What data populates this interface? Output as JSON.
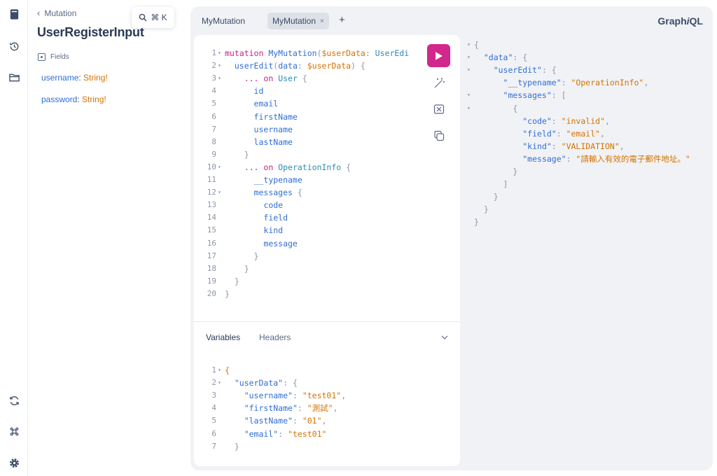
{
  "docs": {
    "back_label": "Mutation",
    "title": "UserRegisterInput",
    "fields_label": "Fields",
    "fields": [
      {
        "name": "username",
        "type": "String",
        "suffix": "!"
      },
      {
        "name": "password",
        "type": "String",
        "suffix": "!"
      }
    ]
  },
  "search": {
    "label": "⌘ K"
  },
  "tabs": [
    {
      "label": "MyMutation"
    },
    {
      "label": "MyMutation",
      "close": "×"
    }
  ],
  "tab_add": "+",
  "brand": {
    "prefix": "Graph",
    "italic": "i",
    "suffix": "QL"
  },
  "variables_tab": "Variables",
  "headers_tab": "Headers",
  "colors": {
    "accent": "#d2278c",
    "field": "#2f6ed6",
    "type": "#d47300",
    "keyword": "#c4237f"
  },
  "icons": {
    "rail": [
      "docs-icon",
      "history-icon",
      "explorer-icon",
      "refetch-schema-icon",
      "shortcuts-icon",
      "settings-icon"
    ],
    "editor_tools": [
      "run-icon",
      "prettify-icon",
      "merge-icon",
      "copy-icon"
    ]
  },
  "query_lines": [
    [
      "1",
      [
        [
          "kw",
          "mutation "
        ],
        [
          "op",
          "MyMutation"
        ],
        [
          "pn",
          "("
        ],
        [
          "var",
          "$userData"
        ],
        [
          "pn",
          ": "
        ],
        [
          "ty",
          "UserEdi"
        ]
      ]
    ],
    [
      "2",
      [
        [
          "pn",
          "  "
        ],
        [
          "fd",
          "userEdit"
        ],
        [
          "pn",
          "("
        ],
        [
          "fd",
          "data"
        ],
        [
          "pn",
          ": "
        ],
        [
          "var",
          "$userData"
        ],
        [
          "pn",
          ") {"
        ]
      ]
    ],
    [
      "3",
      [
        [
          "pn",
          "    "
        ],
        [
          "kw",
          "... on "
        ],
        [
          "ty",
          "User"
        ],
        [
          "pn",
          " {"
        ]
      ]
    ],
    [
      "4",
      [
        [
          "pn",
          "      "
        ],
        [
          "fd",
          "id"
        ]
      ]
    ],
    [
      "5",
      [
        [
          "pn",
          "      "
        ],
        [
          "fd",
          "email"
        ]
      ]
    ],
    [
      "6",
      [
        [
          "pn",
          "      "
        ],
        [
          "fd",
          "firstName"
        ]
      ]
    ],
    [
      "7",
      [
        [
          "pn",
          "      "
        ],
        [
          "fd",
          "username"
        ]
      ]
    ],
    [
      "8",
      [
        [
          "pn",
          "      "
        ],
        [
          "fd",
          "lastName"
        ]
      ]
    ],
    [
      "9",
      [
        [
          "pn",
          "    }"
        ]
      ]
    ],
    [
      "10",
      [
        [
          "pn",
          "    "
        ],
        [
          "kw",
          "... on "
        ],
        [
          "ty",
          "OperationInfo"
        ],
        [
          "pn",
          " {"
        ]
      ]
    ],
    [
      "11",
      [
        [
          "pn",
          "      "
        ],
        [
          "fd",
          "__typename"
        ]
      ]
    ],
    [
      "12",
      [
        [
          "pn",
          "      "
        ],
        [
          "fd",
          "messages"
        ],
        [
          "pn",
          " {"
        ]
      ]
    ],
    [
      "13",
      [
        [
          "pn",
          "        "
        ],
        [
          "fd",
          "code"
        ]
      ]
    ],
    [
      "14",
      [
        [
          "pn",
          "        "
        ],
        [
          "fd",
          "field"
        ]
      ]
    ],
    [
      "15",
      [
        [
          "pn",
          "        "
        ],
        [
          "fd",
          "kind"
        ]
      ]
    ],
    [
      "16",
      [
        [
          "pn",
          "        "
        ],
        [
          "fd",
          "message"
        ]
      ]
    ],
    [
      "17",
      [
        [
          "pn",
          "      }"
        ]
      ]
    ],
    [
      "18",
      [
        [
          "pn",
          "    }"
        ]
      ]
    ],
    [
      "19",
      [
        [
          "pn",
          "  }"
        ]
      ]
    ],
    [
      "20",
      [
        [
          "pn",
          "}"
        ]
      ]
    ]
  ],
  "variables_lines": [
    [
      "1",
      [
        [
          "st",
          "{"
        ]
      ]
    ],
    [
      "2",
      [
        [
          "pn",
          "  "
        ],
        [
          "jk",
          "\"userData\""
        ],
        [
          "pn",
          ": {"
        ]
      ]
    ],
    [
      "3",
      [
        [
          "pn",
          "    "
        ],
        [
          "jk",
          "\"username\""
        ],
        [
          "pn",
          ": "
        ],
        [
          "st",
          "\"test01\""
        ],
        [
          "pn",
          ","
        ]
      ]
    ],
    [
      "4",
      [
        [
          "pn",
          "    "
        ],
        [
          "jk",
          "\"firstName\""
        ],
        [
          "pn",
          ": "
        ],
        [
          "st",
          "\"測試\""
        ],
        [
          "pn",
          ","
        ]
      ]
    ],
    [
      "5",
      [
        [
          "pn",
          "    "
        ],
        [
          "jk",
          "\"lastName\""
        ],
        [
          "pn",
          ": "
        ],
        [
          "st",
          "\"01\""
        ],
        [
          "pn",
          ","
        ]
      ]
    ],
    [
      "6",
      [
        [
          "pn",
          "    "
        ],
        [
          "jk",
          "\"email\""
        ],
        [
          "pn",
          ": "
        ],
        [
          "st",
          "\"test01\""
        ]
      ]
    ],
    [
      "7",
      [
        [
          "pn",
          "  }"
        ]
      ]
    ]
  ],
  "result_lines": [
    [
      [
        [
          "pn",
          "{"
        ]
      ]
    ],
    [
      [
        [
          "pn",
          "  "
        ],
        [
          "jk",
          "\"data\""
        ],
        [
          "pn",
          ": {"
        ]
      ]
    ],
    [
      [
        [
          "pn",
          "    "
        ],
        [
          "jk",
          "\"userEdit\""
        ],
        [
          "pn",
          ": {"
        ]
      ]
    ],
    [
      [
        [
          "pn",
          "      "
        ],
        [
          "jk",
          "\"__typename\""
        ],
        [
          "pn",
          ": "
        ],
        [
          "st",
          "\"OperationInfo\""
        ],
        [
          "pn",
          ","
        ]
      ]
    ],
    [
      [
        [
          "pn",
          "      "
        ],
        [
          "jk",
          "\"messages\""
        ],
        [
          "pn",
          ": ["
        ]
      ]
    ],
    [
      [
        [
          "pn",
          "        {"
        ]
      ]
    ],
    [
      [
        [
          "pn",
          "          "
        ],
        [
          "jk",
          "\"code\""
        ],
        [
          "pn",
          ": "
        ],
        [
          "st",
          "\"invalid\""
        ],
        [
          "pn",
          ","
        ]
      ]
    ],
    [
      [
        [
          "pn",
          "          "
        ],
        [
          "jk",
          "\"field\""
        ],
        [
          "pn",
          ": "
        ],
        [
          "st",
          "\"email\""
        ],
        [
          "pn",
          ","
        ]
      ]
    ],
    [
      [
        [
          "pn",
          "          "
        ],
        [
          "jk",
          "\"kind\""
        ],
        [
          "pn",
          ": "
        ],
        [
          "st",
          "\"VALIDATION\""
        ],
        [
          "pn",
          ","
        ]
      ]
    ],
    [
      [
        [
          "pn",
          "          "
        ],
        [
          "jk",
          "\"message\""
        ],
        [
          "pn",
          ": "
        ],
        [
          "st",
          "\"請輸入有效的電子郵件地址。\""
        ]
      ]
    ],
    [
      [
        [
          "pn",
          "        }"
        ]
      ]
    ],
    [
      [
        [
          "pn",
          "      ]"
        ]
      ]
    ],
    [
      [
        [
          "pn",
          "    }"
        ]
      ]
    ],
    [
      [
        [
          "pn",
          "  }"
        ]
      ]
    ],
    [
      [
        [
          "pn",
          "}"
        ]
      ]
    ]
  ]
}
